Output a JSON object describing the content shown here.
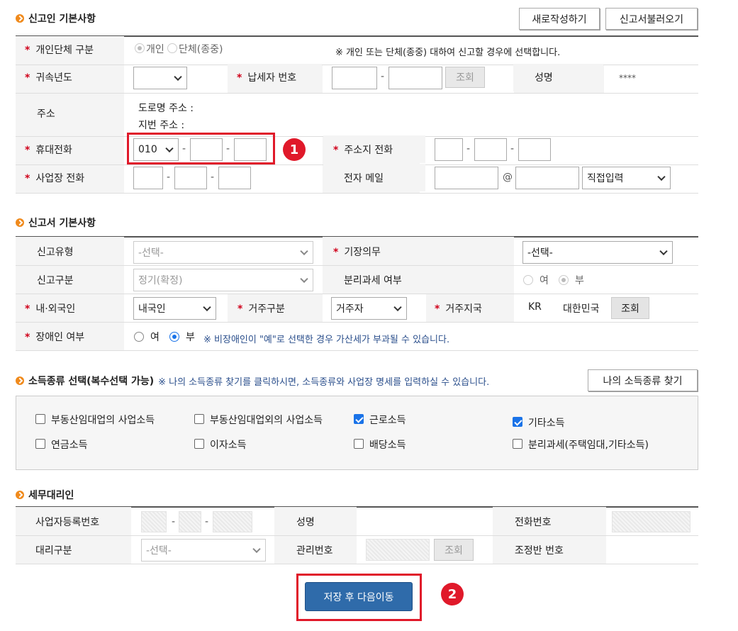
{
  "section1": {
    "title": "신고인 기본사항",
    "new_button": "새로작성하기",
    "load_button": "신고서불러오기",
    "type_label": "개인단체 구분",
    "type_options": [
      "개인",
      "단체(종중)"
    ],
    "type_note": "※ 개인 또는 단체(종중) 대하여 신고할 경우에 선택합니다.",
    "year_label": "귀속년도",
    "taxpayer_label": "납세자 번호",
    "lookup_button": "조회",
    "name_label": "성명",
    "name_value": "****",
    "address_label": "주소",
    "road_address": "도로명 주소 :",
    "lot_address": "지번 주소 :",
    "mobile_label": "휴대전화",
    "mobile_prefix": "010",
    "home_phone_label": "주소지 전화",
    "biz_phone_label": "사업장 전화",
    "email_label": "전자 메일",
    "email_at": "@",
    "email_domain": "직접입력"
  },
  "section2": {
    "title": "신고서 기본사항",
    "report_type_label": "신고유형",
    "report_type_value": "-선택-",
    "bookkeeping_label": "기장의무",
    "bookkeeping_value": "-선택-",
    "report_kind_label": "신고구분",
    "report_kind_value": "정기(확정)",
    "separate_tax_label": "분리과세 여부",
    "yes": "여",
    "no": "부",
    "nationality_label": "내·외국인",
    "nationality_value": "내국인",
    "residence_label": "거주구분",
    "residence_value": "거주자",
    "country_label": "거주지국",
    "country_code": "KR",
    "country_name": "대한민국",
    "country_lookup": "조회",
    "disabled_label": "장애인 여부",
    "disabled_note": "※ 비장애인이 \"예\"로 선택한 경우 가산세가 부과될 수 있습니다."
  },
  "section3": {
    "title": "소득종류 선택(복수선택 가능)",
    "note": "※ 나의 소득종류 찾기를 클릭하시면, 소득종류와 사업장 명세를 입력하실 수 있습니다.",
    "find_button": "나의 소득종류 찾기",
    "options": [
      {
        "label": "부동산임대업의 사업소득",
        "checked": false
      },
      {
        "label": "부동산임대업외의 사업소득",
        "checked": false
      },
      {
        "label": "근로소득",
        "checked": true
      },
      {
        "label": "기타소득",
        "checked": true
      },
      {
        "label": "연금소득",
        "checked": false
      },
      {
        "label": "이자소득",
        "checked": false
      },
      {
        "label": "배당소득",
        "checked": false
      },
      {
        "label": "분리과세(주택임대,기타소득)",
        "checked": false
      }
    ]
  },
  "section4": {
    "title": "세무대리인",
    "reg_no_label": "사업자등록번호",
    "name_label": "성명",
    "phone_label": "전화번호",
    "agent_type_label": "대리구분",
    "agent_type_value": "-선택-",
    "mgmt_no_label": "관리번호",
    "lookup_button": "조회",
    "adjust_no_label": "조정반 번호"
  },
  "footer": {
    "submit_button": "저장 후 다음이동"
  },
  "badges": [
    "1",
    "2"
  ],
  "colors": {
    "accent": "#2f6baa",
    "highlight": "#e0192a",
    "required": "#d0021b",
    "bullet": "#f08a1c"
  }
}
